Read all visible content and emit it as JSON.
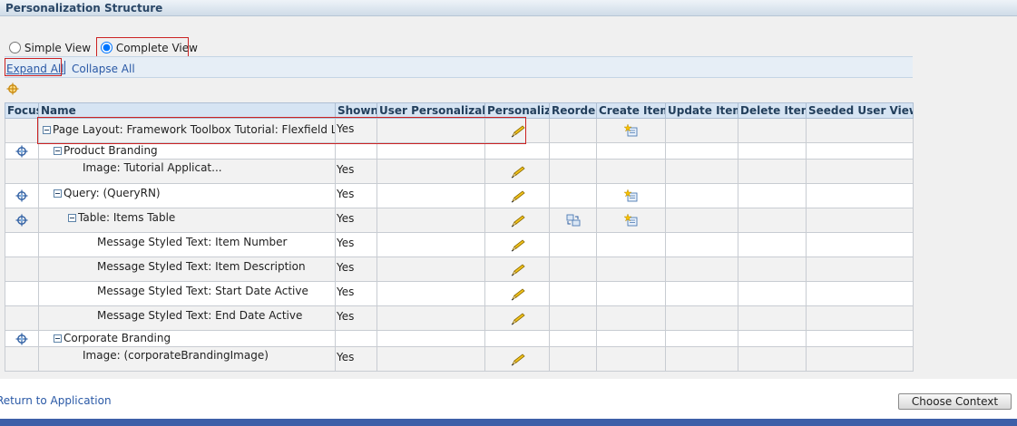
{
  "header": {
    "title": "Personalization Structure"
  },
  "view": {
    "simple_label": "Simple View",
    "complete_label": "Complete View",
    "selected": "Complete View"
  },
  "toolbar": {
    "expand_all": "Expand All",
    "collapse_all": "Collapse All"
  },
  "columns": [
    "Focus",
    "Name",
    "Shown",
    "User Personalizable",
    "Personalize",
    "Reorder",
    "Create Item",
    "Update Item",
    "Delete Item",
    "Seeded User Views"
  ],
  "rows": [
    {
      "name": "Page Layout: Framework Toolbox Tutorial: Flexfield Labs",
      "shown": "Yes"
    },
    {
      "name": "Product Branding",
      "shown": ""
    },
    {
      "name": "Image: Tutorial Applicat...",
      "shown": "Yes"
    },
    {
      "name": "Query: (QueryRN)",
      "shown": "Yes"
    },
    {
      "name": "Table: Items Table",
      "shown": "Yes"
    },
    {
      "name": "Message Styled Text: Item Number",
      "shown": "Yes"
    },
    {
      "name": "Message Styled Text: Item Description",
      "shown": "Yes"
    },
    {
      "name": "Message Styled Text: Start Date Active",
      "shown": "Yes"
    },
    {
      "name": "Message Styled Text: End Date Active",
      "shown": "Yes"
    },
    {
      "name": "Corporate Branding",
      "shown": ""
    },
    {
      "name": "Image: (corporateBrandingImage)",
      "shown": "Yes"
    }
  ],
  "footer": {
    "return_link": "Return to Application",
    "choose_context": "Choose Context"
  },
  "icons": {
    "focus": "crosshair-icon",
    "personalize": "pencil-icon",
    "create_item": "create-item-icon",
    "reorder": "reorder-icon",
    "toggle": "collapse-minus-icon"
  },
  "colors": {
    "header_bg": "#d6e4f3",
    "link": "#2a59a6",
    "highlight": "#cc2222",
    "bottom_bar": "#3d5fa8"
  }
}
